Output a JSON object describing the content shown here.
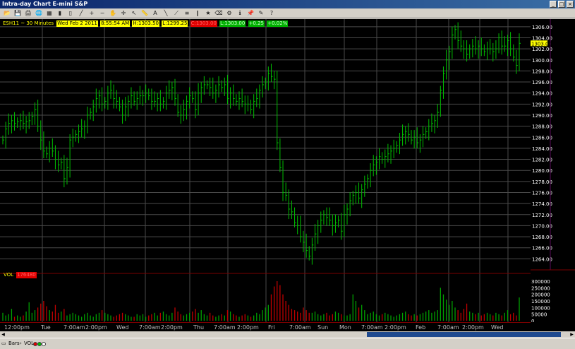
{
  "window": {
    "title": "Intra-day Chart E-mini S&P",
    "controls": [
      "_",
      "□",
      "×"
    ]
  },
  "toolbar": {
    "icons": [
      "open-icon",
      "save-icon",
      "print-icon",
      "globe-icon",
      "grid-icon",
      "bar-icon",
      "candle-icon",
      "line-icon",
      "zoom-in-icon",
      "zoom-out-icon",
      "hand-icon",
      "crosshair-icon",
      "pointer-icon",
      "ruler-icon",
      "text-icon",
      "line-draw-icon",
      "trend-icon",
      "fib-icon",
      "channel-icon",
      "star-icon",
      "eraser-icon",
      "gear-icon",
      "info-icon",
      "pin-icon",
      "pen-icon",
      "help-icon"
    ],
    "glyphs": [
      "📂",
      "💾",
      "🖨",
      "🌐",
      "▦",
      "▮",
      "▯",
      "╱",
      "+",
      "−",
      "✋",
      "✛",
      "↖",
      "📏",
      "A",
      "╲",
      "⟋",
      "≡",
      "∥",
      "★",
      "⌫",
      "⚙",
      "ℹ",
      "📌",
      "✎",
      "?"
    ]
  },
  "header": {
    "symbol": "ESH11 ~ 30 Minutes",
    "date": "Wed Feb 2 2011",
    "time": "8:55:54 AM",
    "high": "H:1303.50",
    "low": "L:1299.25",
    "close": "C:1303.00",
    "last": "L:1303.00",
    "change": "+0.25",
    "pct": "+0.02%"
  },
  "volume": {
    "label": "VOL",
    "value": "176480"
  },
  "price_axis": {
    "ticks": [
      "1306.00",
      "1304.00",
      "1302.00",
      "1300.00",
      "1298.00",
      "1296.00",
      "1294.00",
      "1292.00",
      "1290.00",
      "1288.00",
      "1286.00",
      "1284.00",
      "1282.00",
      "1280.00",
      "1278.00",
      "1276.00",
      "1274.00",
      "1272.00",
      "1270.00",
      "1268.00",
      "1266.00",
      "1264.00"
    ],
    "current": "1303.00",
    "vol_ticks": [
      "300000",
      "250000",
      "200000",
      "150000",
      "100000",
      "50000",
      "0"
    ]
  },
  "time_axis": {
    "labels": [
      "12:00pm",
      "Tue",
      "7:00am",
      "2:00pm",
      "Wed",
      "7:00am",
      "2:00pm",
      "Thu",
      "7:00am",
      "2:00pm",
      "Fri",
      "7:00am",
      "Sun",
      "Mon",
      "7:00am",
      "2:00pm",
      "Feb",
      "7:00am",
      "2:00pm",
      "Wed"
    ]
  },
  "status": {
    "bars": "Bars",
    "vol": "VOL"
  },
  "colors": {
    "up": "#00c000",
    "down": "#20a020",
    "vol_up": "#00a000",
    "vol_down": "#c00000",
    "grid": "#4a4a4a"
  },
  "chart_data": {
    "type": "line",
    "title": "ESH11 ~ 30 Minutes",
    "ylim": [
      1262,
      1307
    ],
    "closes": [
      1285.5,
      1287.5,
      1288.5,
      1289.0,
      1288.5,
      1288.8,
      1289.0,
      1288.5,
      1288.8,
      1289.0,
      1289.8,
      1291.0,
      1288.0,
      1285.5,
      1283.5,
      1283.0,
      1284.0,
      1283.5,
      1282.0,
      1281.0,
      1281.5,
      1278.5,
      1280.5,
      1285.5,
      1286.0,
      1286.5,
      1287.0,
      1287.5,
      1288.0,
      1290.0,
      1290.5,
      1291.5,
      1293.0,
      1293.5,
      1292.0,
      1292.5,
      1294.0,
      1294.5,
      1293.0,
      1292.5,
      1291.5,
      1290.0,
      1291.5,
      1292.5,
      1293.5,
      1292.5,
      1293.0,
      1293.5,
      1293.5,
      1294.0,
      1293.5,
      1292.5,
      1292.5,
      1293.0,
      1292.0,
      1292.5,
      1294.0,
      1294.5,
      1295.0,
      1293.0,
      1290.5,
      1290.0,
      1291.0,
      1292.5,
      1293.5,
      1293.0,
      1291.0,
      1294.0,
      1295.0,
      1295.5,
      1295.5,
      1295.0,
      1294.0,
      1294.5,
      1295.5,
      1295.0,
      1295.5,
      1293.0,
      1294.0,
      1293.0,
      1292.5,
      1293.0,
      1292.5,
      1292.0,
      1292.0,
      1291.0,
      1292.5,
      1293.0,
      1294.5,
      1295.5,
      1296.0,
      1297.5,
      1297.0,
      1296.5,
      1285.0,
      1280.5,
      1276.0,
      1275.5,
      1273.0,
      1272.5,
      1270.5,
      1270.0,
      1268.0,
      1267.0,
      1265.5,
      1264.5,
      1266.5,
      1268.5,
      1270.0,
      1271.0,
      1272.0,
      1271.5,
      1271.0,
      1270.0,
      1270.5,
      1271.0,
      1269.0,
      1272.0,
      1273.0,
      1274.5,
      1275.5,
      1276.0,
      1275.0,
      1276.5,
      1277.5,
      1278.5,
      1280.0,
      1281.0,
      1281.5,
      1282.5,
      1282.0,
      1282.5,
      1283.0,
      1283.5,
      1284.0,
      1284.5,
      1285.5,
      1286.5,
      1287.0,
      1286.5,
      1285.5,
      1286.0,
      1285.0,
      1285.5,
      1286.5,
      1287.0,
      1288.0,
      1288.5,
      1289.0,
      1290.5,
      1294.5,
      1297.5,
      1300.0,
      1301.5,
      1304.5,
      1305.5,
      1303.5,
      1302.5,
      1302.0,
      1301.0,
      1302.0,
      1302.5,
      1302.0,
      1302.5,
      1302.0,
      1301.5,
      1302.0,
      1302.0,
      1301.5,
      1302.0,
      1304.0,
      1302.5,
      1302.5,
      1303.5,
      1302.0,
      1300.5,
      1299.0,
      1303.0
    ],
    "volume": [
      60000,
      40000,
      50000,
      90000,
      30000,
      40000,
      30000,
      40000,
      70000,
      140000,
      60000,
      80000,
      100000,
      130000,
      150000,
      110000,
      80000,
      70000,
      120000,
      60000,
      70000,
      90000,
      40000,
      50000,
      60000,
      50000,
      40000,
      30000,
      50000,
      60000,
      40000,
      30000,
      50000,
      60000,
      80000,
      60000,
      50000,
      40000,
      30000,
      40000,
      50000,
      60000,
      50000,
      40000,
      30000,
      30000,
      50000,
      40000,
      50000,
      30000,
      40000,
      50000,
      60000,
      40000,
      60000,
      70000,
      50000,
      40000,
      60000,
      100000,
      70000,
      50000,
      40000,
      50000,
      60000,
      70000,
      90000,
      60000,
      80000,
      50000,
      40000,
      60000,
      40000,
      30000,
      40000,
      50000,
      40000,
      80000,
      70000,
      50000,
      40000,
      30000,
      40000,
      50000,
      40000,
      30000,
      40000,
      60000,
      50000,
      80000,
      100000,
      120000,
      200000,
      260000,
      300000,
      270000,
      200000,
      150000,
      120000,
      90000,
      80000,
      70000,
      60000,
      100000,
      80000,
      60000,
      60000,
      70000,
      50000,
      40000,
      50000,
      60000,
      40000,
      50000,
      70000,
      60000,
      50000,
      40000,
      40000,
      50000,
      200000,
      150000,
      100000,
      120000,
      80000,
      50000,
      60000,
      70000,
      50000,
      40000,
      50000,
      60000,
      50000,
      40000,
      30000,
      40000,
      50000,
      60000,
      70000,
      50000,
      40000,
      50000,
      40000,
      50000,
      60000,
      70000,
      80000,
      60000,
      70000,
      80000,
      250000,
      200000,
      160000,
      120000,
      150000,
      100000,
      80000,
      60000,
      90000,
      130000,
      70000,
      60000,
      50000,
      60000,
      40000,
      50000,
      60000,
      50000,
      40000,
      60000,
      50000,
      40000,
      60000,
      80000,
      50000,
      60000,
      40000,
      176480
    ]
  }
}
